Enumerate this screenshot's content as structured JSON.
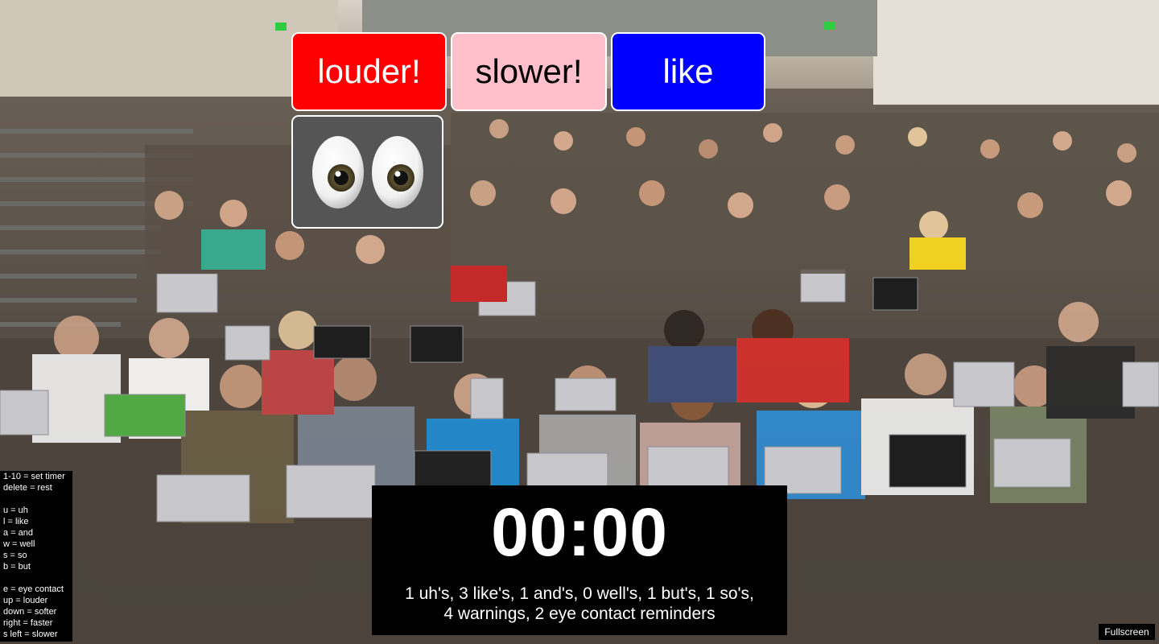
{
  "reminders": {
    "louder": "louder!",
    "slower": "slower!",
    "like": "like",
    "eyes_icon": "eyes-emoji"
  },
  "help": {
    "lines_group1": [
      "1-10 = set timer",
      "delete = rest"
    ],
    "lines_group2": [
      "u = uh",
      "l = like",
      "a = and",
      "w = well",
      "s = so",
      "b = but"
    ],
    "lines_group3": [
      "e = eye contact",
      "up = louder",
      "down = softer",
      "right = faster",
      "s left = slower"
    ]
  },
  "timer": {
    "clock": "00:00",
    "stats_line1": "1 uh's, 3 like's, 1 and's, 0 well's, 1 but's, 1 so's,",
    "stats_line2": "4 warnings, 2 eye contact reminders"
  },
  "fullscreen_label": "Fullscreen",
  "colors": {
    "louder_bg": "#ff0000",
    "slower_bg": "#ffc0cb",
    "like_bg": "#0000ff",
    "eyes_bg": "#555555",
    "panel_bg": "#000000"
  }
}
